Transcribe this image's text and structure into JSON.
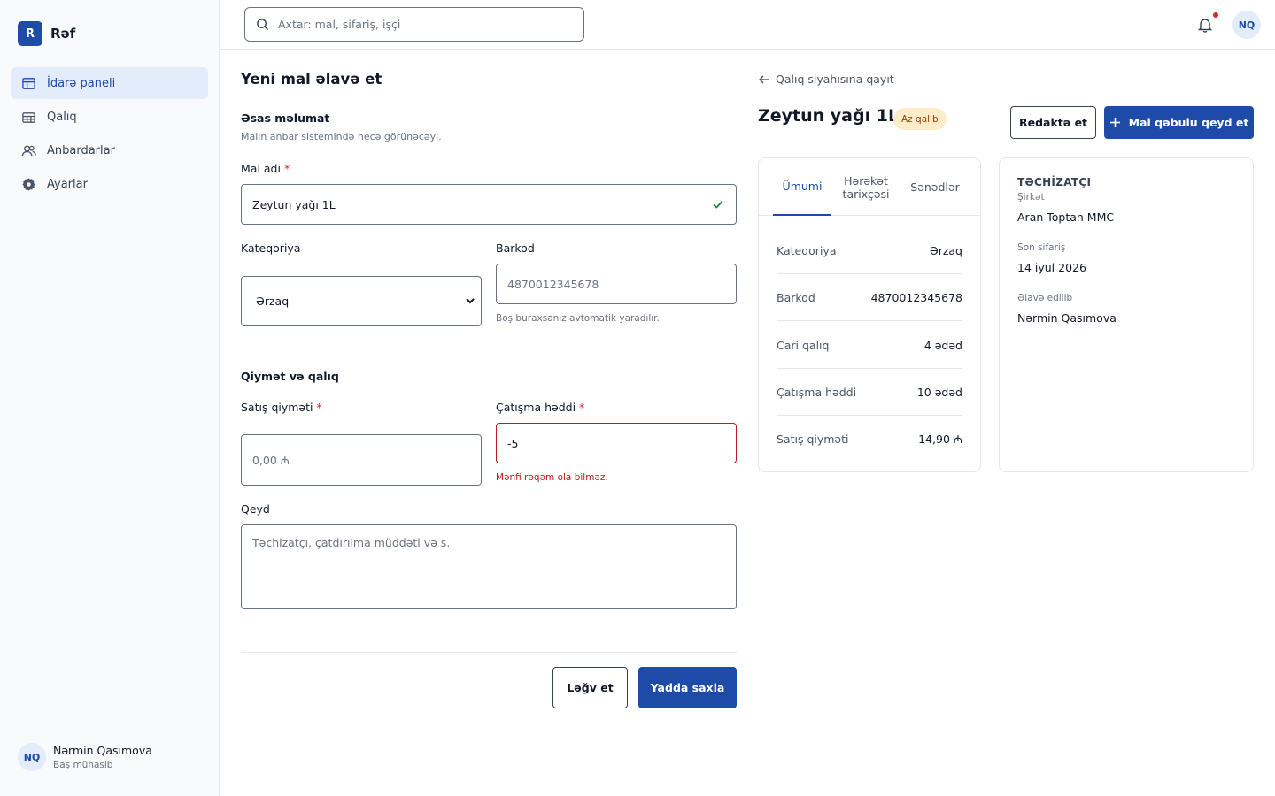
{
  "app": {
    "brand_letter": "R",
    "brand_name": "Rəf"
  },
  "sidebar": {
    "items": [
      {
        "label": "İdarə paneli",
        "icon": "dashboard-icon",
        "active": true
      },
      {
        "label": "Qalıq",
        "icon": "table-icon",
        "active": false
      },
      {
        "label": "Anbardarlar",
        "icon": "users-icon",
        "active": false
      },
      {
        "label": "Ayarlar",
        "icon": "gear-icon",
        "active": false
      }
    ],
    "user": {
      "initials": "NQ",
      "name": "Nərmin Qasımova",
      "role": "Baş mühasib"
    }
  },
  "topbar": {
    "search_placeholder": "Axtar: mal, sifariş, işçi",
    "avatar_initials": "NQ"
  },
  "form": {
    "title": "Yeni mal əlavə et",
    "section1": {
      "title": "Əsas məlumat",
      "subtitle": "Malın anbar sistemində necə görünəcəyi."
    },
    "name": {
      "label": "Mal adı",
      "required": "*",
      "value": "Zeytun yağı 1L"
    },
    "category": {
      "label": "Kateqoriya",
      "value": "Ərzaq"
    },
    "barcode": {
      "label": "Barkod",
      "placeholder": "4870012345678",
      "hint": "Boş buraxsanız avtomatik yaradılır."
    },
    "section2": {
      "title": "Qiymət və qalıq"
    },
    "price": {
      "label": "Satış qiyməti",
      "required": "*",
      "placeholder": "0,00 ₼"
    },
    "threshold": {
      "label": "Çatışma həddi",
      "required": "*",
      "value": "-5",
      "error": "Mənfi rəqəm ola bilməz."
    },
    "note": {
      "label": "Qeyd",
      "placeholder": "Təchizatçı, çatdırılma müddəti və s."
    },
    "cancel_label": "Ləğv et",
    "save_label": "Yadda saxla"
  },
  "detail": {
    "back_label": "Qalıq siyahısına qayıt",
    "title": "Zeytun yağı 1L",
    "badge": "Az qalıb",
    "edit_label": "Redaktə et",
    "receive_label": "Mal qəbulu qeyd et",
    "tabs": [
      {
        "label": "Ümumi",
        "active": true
      },
      {
        "label": "Hərəkət tarixçəsi",
        "active": false
      },
      {
        "label": "Sənədlər",
        "active": false
      }
    ],
    "rows": [
      {
        "key": "Kateqoriya",
        "value": "Ərzaq"
      },
      {
        "key": "Barkod",
        "value": "4870012345678"
      },
      {
        "key": "Cari qalıq",
        "value": "4 ədəd"
      },
      {
        "key": "Çatışma həddi",
        "value": "10 ədəd"
      },
      {
        "key": "Satış qiyməti",
        "value": "14,90 ₼"
      }
    ],
    "supplier": {
      "title": "TƏCHİZATÇI",
      "company_label": "Şirkət",
      "company": "Aran Toptan MMC",
      "last_order_label": "Son sifariş",
      "last_order": "14 iyul 2026",
      "added_by_label": "Əlavə edilib",
      "added_by": "Nərmin Qasımova"
    }
  },
  "colors": {
    "primary": "#1e4aa8",
    "error": "#b91c1c",
    "badge_bg": "#fdecc8",
    "badge_text": "#92400e",
    "active_nav_bg": "#e3ecfb"
  }
}
